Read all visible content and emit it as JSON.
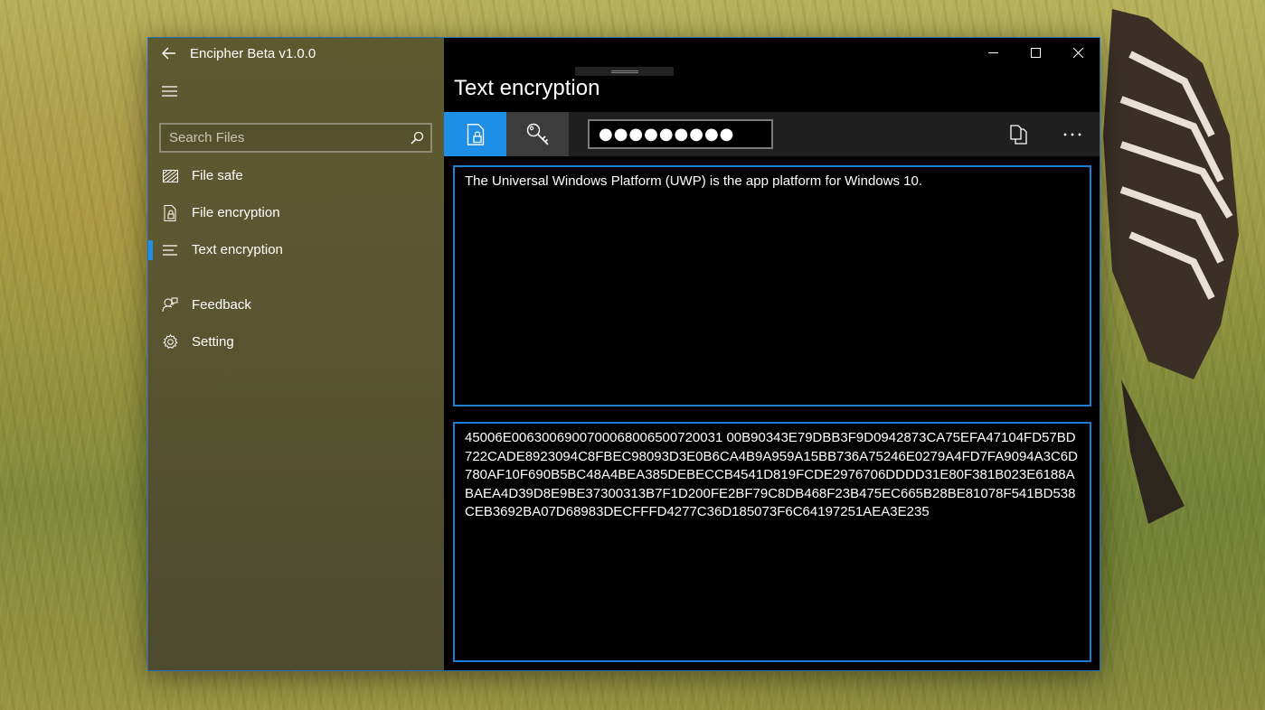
{
  "window": {
    "app_title": "Encipher  Beta v1.0.0",
    "page_title": "Text encryption"
  },
  "nav": {
    "search_placeholder": "Search Files",
    "items": [
      {
        "label": "File safe",
        "icon": "file-safe-icon"
      },
      {
        "label": "File encryption",
        "icon": "file-lock-icon"
      },
      {
        "label": "Text encryption",
        "icon": "text-lines-icon",
        "selected": true
      }
    ],
    "footer_items": [
      {
        "label": "Feedback",
        "icon": "feedback-icon"
      },
      {
        "label": "Setting",
        "icon": "gear-icon"
      }
    ]
  },
  "toolbar": {
    "password_value": "●●●●●●●●●",
    "encrypt_icon": "lock-file-icon",
    "key_icon": "key-icon",
    "copy_icon": "copy-icon",
    "more_icon": "more-icon"
  },
  "editor": {
    "plain_text": "The Universal Windows Platform (UWP) is the app platform for Windows 10.",
    "cipher_text": "45006E0063006900700068006500720031 00B90343E79DBB3F9D0942873CA75EFA47104FD57BD722CADE8923094C8FBEC98093D3E0B6CA4B9A959A15BB736A75246E0279A4FD7FA9094A3C6D780AF10F690B5BC48A4BEA385DEBECCB4541D819FCDE2976706DDDD31E80F381B023E6188ABAEA4D39D8E9BE37300313B7F1D200FE2BF79C8DB468F23B475EC665B28BE81078F541BD538CEB3692BA07D68983DECFFFD4277C36D185073F6C64197251AEA3E235"
  },
  "colors": {
    "accent": "#1e8fe6",
    "nav_bg": "#5a5631",
    "main_bg": "#000000"
  }
}
